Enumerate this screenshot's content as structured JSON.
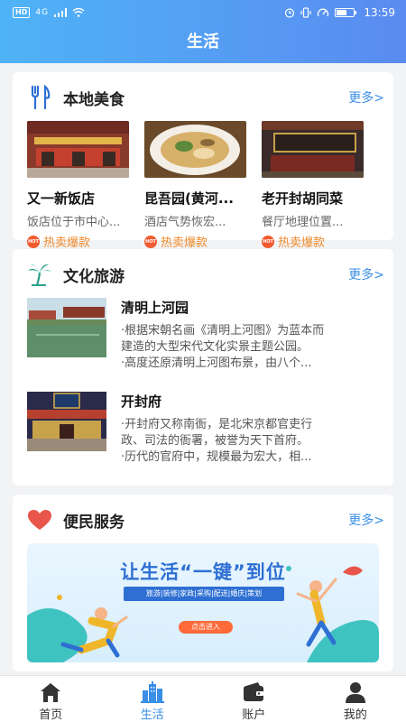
{
  "status": {
    "time": "13:59",
    "hd": "HD",
    "network": "4G",
    "battery_level": 0.6
  },
  "page_title": "生活",
  "food": {
    "title": "本地美食",
    "more": "更多>",
    "items": [
      {
        "name": "又一新饭店",
        "desc": "饭店位于市中心...",
        "tag": "热卖爆款"
      },
      {
        "name": "昆吾园(黄河...",
        "desc": "酒店气势恢宏...",
        "tag": "热卖爆款"
      },
      {
        "name": "老开封胡同菜",
        "desc": "餐厅地理位置...",
        "tag": "热卖爆款"
      }
    ],
    "hot_label": "HOT"
  },
  "culture": {
    "title": "文化旅游",
    "more": "更多>",
    "items": [
      {
        "name": "清明上河园",
        "line1": "·根据宋朝名画《清明上河图》为蓝本而",
        "line2": "建造的大型宋代文化实景主题公园。",
        "line3": "·高度还原清明上河图布景，由八个..."
      },
      {
        "name": "开封府",
        "line1": "·开封府又称南衙，是北宋京都官吏行",
        "line2": "政、司法的衙署，被誉为天下首府。",
        "line3": "·历代的官府中，规模最为宏大，相..."
      }
    ]
  },
  "service": {
    "title": "便民服务",
    "more": "更多>",
    "banner_title": "让生活“一键”到位",
    "banner_tags": "旅游|装修|家政|采购|配送|婚庆|策划",
    "banner_button": "点击进入"
  },
  "tabs": [
    {
      "label": "首页",
      "icon": "home-icon"
    },
    {
      "label": "生活",
      "icon": "city-icon"
    },
    {
      "label": "账户",
      "icon": "wallet-icon"
    },
    {
      "label": "我的",
      "icon": "user-icon"
    }
  ],
  "colors": {
    "accent": "#3a8ee6",
    "hot_orange": "#f08a2a",
    "header_start": "#4fb3f7",
    "header_end": "#5a8bf0"
  }
}
